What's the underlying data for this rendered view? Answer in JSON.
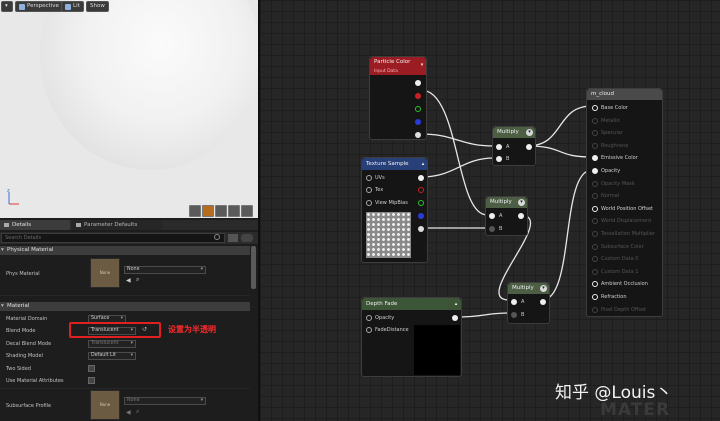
{
  "viewport": {
    "perspective": "Perspective",
    "lit": "Lit",
    "show": "Show"
  },
  "tabs": {
    "details": "Details",
    "param_defaults": "Parameter Defaults"
  },
  "search": {
    "placeholder": "Search Details"
  },
  "physical_material": {
    "category": "Physical Material",
    "phys_label": "Phys Material",
    "phys_value": "None",
    "thumb_text": "None"
  },
  "material": {
    "category": "Material",
    "domain_label": "Material Domain",
    "domain_value": "Surface",
    "blend_label": "Blend Mode",
    "blend_value": "Translucent",
    "decal_label": "Decal Blend Mode",
    "decal_value": "Translucent",
    "shading_label": "Shading Model",
    "shading_value": "Default Lit",
    "twosided_label": "Two Sided",
    "attrs_label": "Use Material Attributes",
    "subsurface_label": "Subsurface Profile",
    "subsurface_value": "None",
    "thumb_text": "None"
  },
  "annotation": "设置为半透明",
  "nodes": {
    "particle": {
      "title": "Particle Color",
      "subtitle": "Input Data"
    },
    "texture": {
      "title": "Texture Sample",
      "pins": [
        "UVs",
        "Tex",
        "View MipBias"
      ]
    },
    "multiply": {
      "title": "Multiply",
      "a": "A",
      "b": "B"
    },
    "depth": {
      "title": "Depth Fade",
      "pins": [
        "Opacity",
        "FadeDistance"
      ]
    },
    "result": {
      "title": "m_cloud",
      "pins": [
        "Base Color",
        "Metallic",
        "Specular",
        "Roughness",
        "Emissive Color",
        "Opacity",
        "Opacity Mask",
        "Normal",
        "World Position Offset",
        "World Displacement",
        "Tessellation Multiplier",
        "Subsurface Color",
        "Custom Data 0",
        "Custom Data 1",
        "Ambient Occlusion",
        "Refraction",
        "Pixel Depth Offset"
      ]
    }
  },
  "watermark": "知乎 @Louis丶",
  "watermark2": "MATER",
  "colors": {
    "particle_header": "#9c1c24",
    "texture_header": "#27407a",
    "multiply_header": "#4c5e44",
    "depth_header": "#3c5536",
    "result_header": "#4a4a4a",
    "annotation": "#ff2a2a"
  }
}
